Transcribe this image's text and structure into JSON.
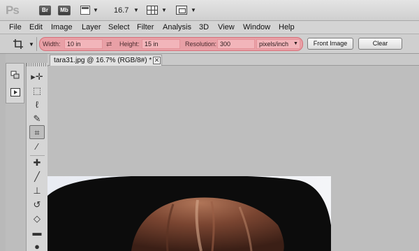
{
  "appbar": {
    "logo": "Ps",
    "bridge_label": "Br",
    "minibridge_label": "Mb",
    "zoom_value": "16.7"
  },
  "menu": [
    "File",
    "Edit",
    "Image",
    "Layer",
    "Select",
    "Filter",
    "Analysis",
    "3D",
    "View",
    "Window",
    "Help"
  ],
  "options": {
    "width_label": "Width:",
    "width_value": "10 in",
    "height_label": "Height:",
    "height_value": "15 in",
    "resolution_label": "Resolution:",
    "resolution_value": "300",
    "resolution_unit": "pixels/inch",
    "front_image_label": "Front Image",
    "clear_label": "Clear",
    "highlight_color": "#e8a0a6"
  },
  "document": {
    "tab_title": "tara31.jpg @ 16.7% (RGB/8#) *",
    "close_glyph": "✕"
  },
  "tools": [
    "move-tool-icon",
    "marquee-tool-icon",
    "lasso-tool-icon",
    "quick-select-tool-icon",
    "crop-tool-icon",
    "eyedropper-tool-icon",
    "healing-brush-tool-icon",
    "brush-tool-icon",
    "clone-stamp-tool-icon",
    "history-brush-tool-icon",
    "eraser-tool-icon",
    "gradient-tool-icon",
    "blur-tool-icon"
  ],
  "dock": [
    "layers-panel-icon",
    "actions-panel-icon"
  ]
}
